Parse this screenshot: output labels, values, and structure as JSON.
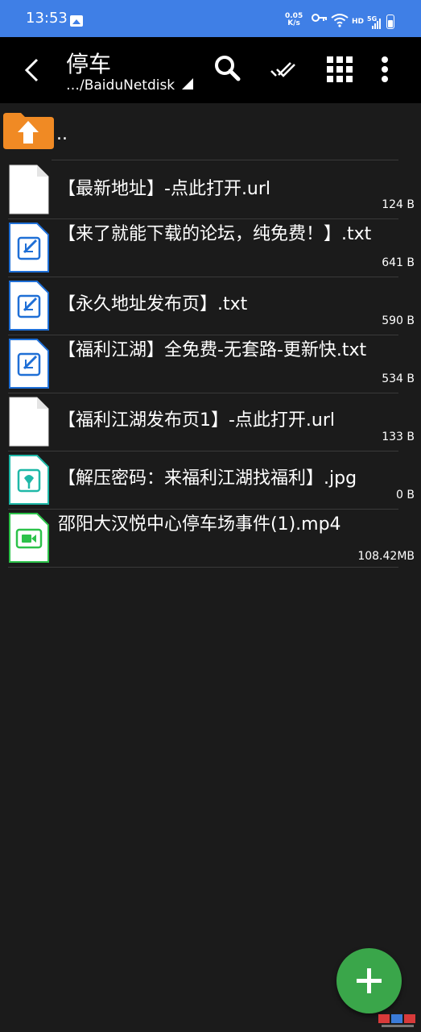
{
  "status_bar": {
    "time": "13:53",
    "net_speed_value": "0.05",
    "net_speed_unit": "K/s",
    "hd_label": "HD",
    "network_label": "5G"
  },
  "toolbar": {
    "title": "停车",
    "path": "…/BaiduNetdisk",
    "icons": [
      "back-arrow-icon",
      "search-icon",
      "double-check-icon",
      "grid-view-icon",
      "more-vert-icon"
    ]
  },
  "parent": {
    "label": ".."
  },
  "files": [
    {
      "name": "【最新地址】-点此打开.url",
      "size": "124 B",
      "type": "url"
    },
    {
      "name": "【来了就能下载的论坛，纯免费！】.txt",
      "size": "641 B",
      "type": "txt"
    },
    {
      "name": "【永久地址发布页】.txt",
      "size": "590 B",
      "type": "txt"
    },
    {
      "name": "【福利江湖】全免费-无套路-更新快.txt",
      "size": "534 B",
      "type": "txt"
    },
    {
      "name": "【福利江湖发布页1】-点此打开.url",
      "size": "133 B",
      "type": "url"
    },
    {
      "name": "【解压密码：来福利江湖找福利】.jpg",
      "size": "0 B",
      "type": "image"
    },
    {
      "name": "邵阳大汉悦中心停车场事件(1).mp4",
      "size": "108.42MB",
      "type": "video"
    }
  ],
  "colors": {
    "status_bar": "#3f7fe6",
    "toolbar": "#000000",
    "background": "#1b1b1b",
    "folder": "#f08a24",
    "txt_icon": "#1f6fd6",
    "image_icon": "#1fb8a8",
    "video_icon": "#2cc24a",
    "fab": "#3aa64a"
  }
}
